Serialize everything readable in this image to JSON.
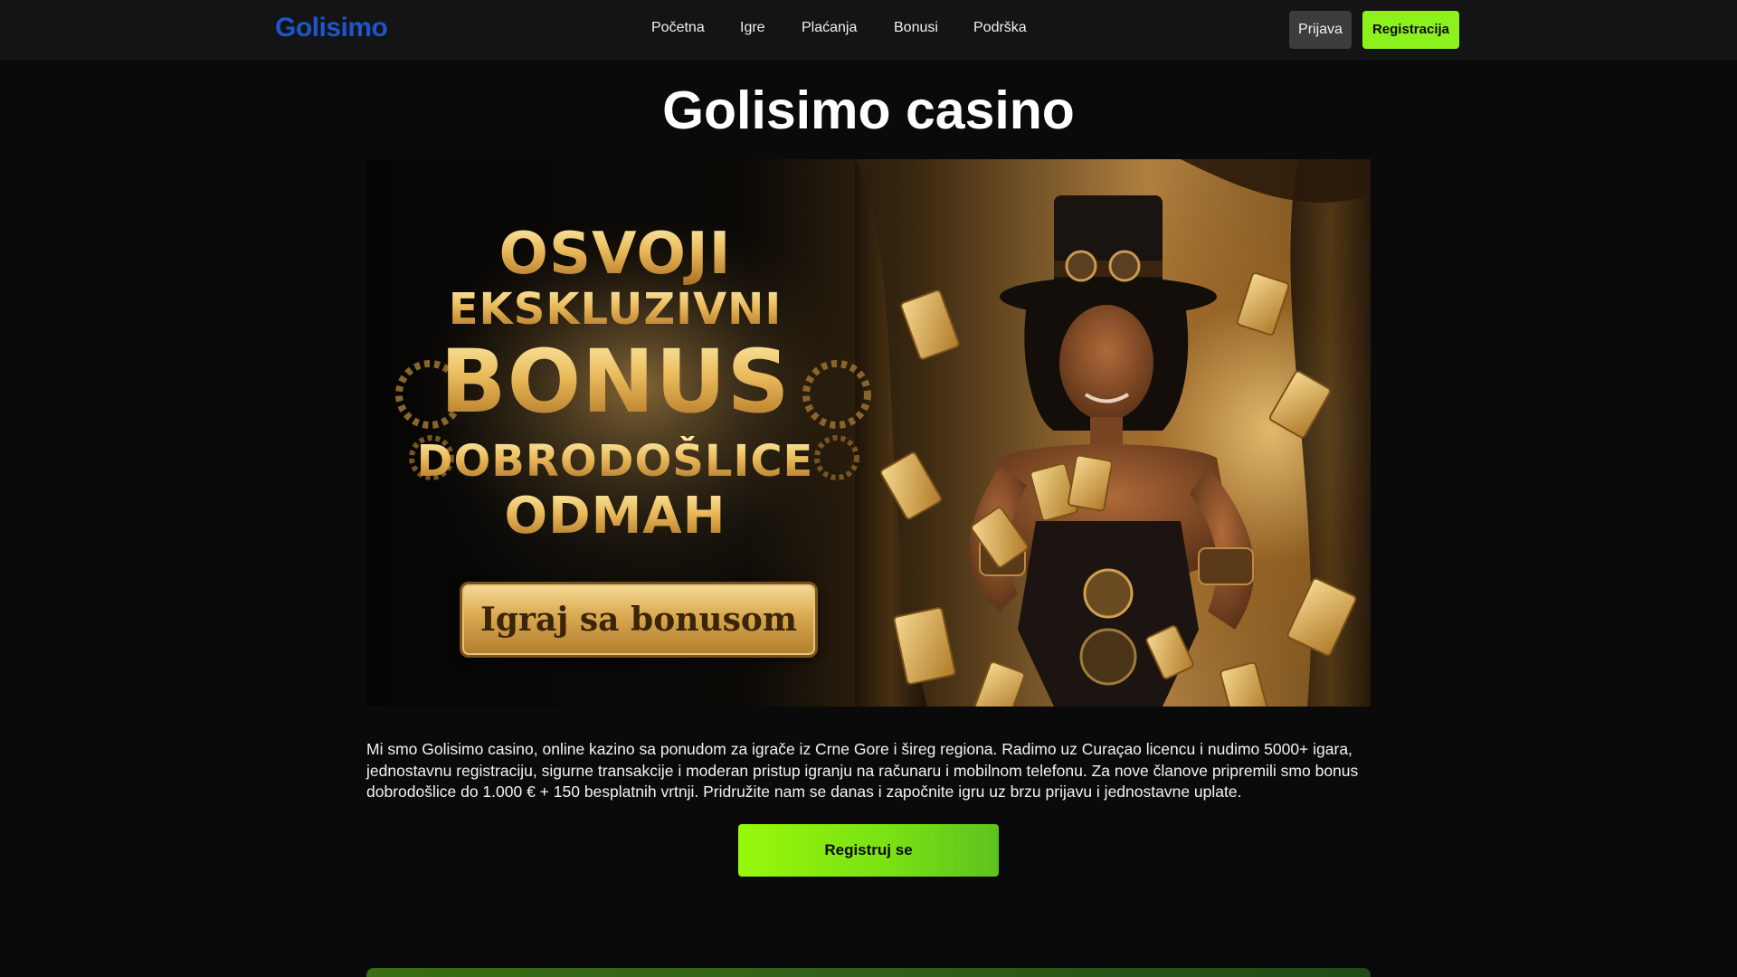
{
  "header": {
    "logo": "Golisimo",
    "nav": [
      {
        "label": "Početna"
      },
      {
        "label": "Igre"
      },
      {
        "label": "Plaćanja"
      },
      {
        "label": "Bonusi"
      },
      {
        "label": "Podrška"
      }
    ],
    "login_label": "Prijava",
    "signup_label": "Registracija"
  },
  "main": {
    "title": "Golisimo casino",
    "banner": {
      "line1": "OSVOJI",
      "line2": "EKSKLUZIVNI",
      "line3": "BONUS",
      "line4": "DOBRODOŠLICE",
      "line5": "ODMAH",
      "cta": "Igraj sa bonusom"
    },
    "intro": "Mi smo Golisimo casino, online kazino sa ponudom za igrače iz Crne Gore i šireg regiona. Radimo uz Curaçao licencu i nudimo 5000+ igara, jednostavnu registraciju, sigurne transakcije i moderan pristup igranju na računaru i mobilnom telefonu. Za nove članove pripremili smo bonus dobrodošlice do 1.000 € + 150 besplatnih vrtnji. Pridružite nam se danas i započnite igru uz brzu prijavu i jednostavne uplate.",
    "cta_label": "Registruj se"
  },
  "colors": {
    "background": "#0a0a0a",
    "header_bg": "#141414",
    "logo": "#1e55c8",
    "accent_green": "#8cf21c",
    "login_bg": "#3c3c3c",
    "gold": "#e9b95a"
  }
}
